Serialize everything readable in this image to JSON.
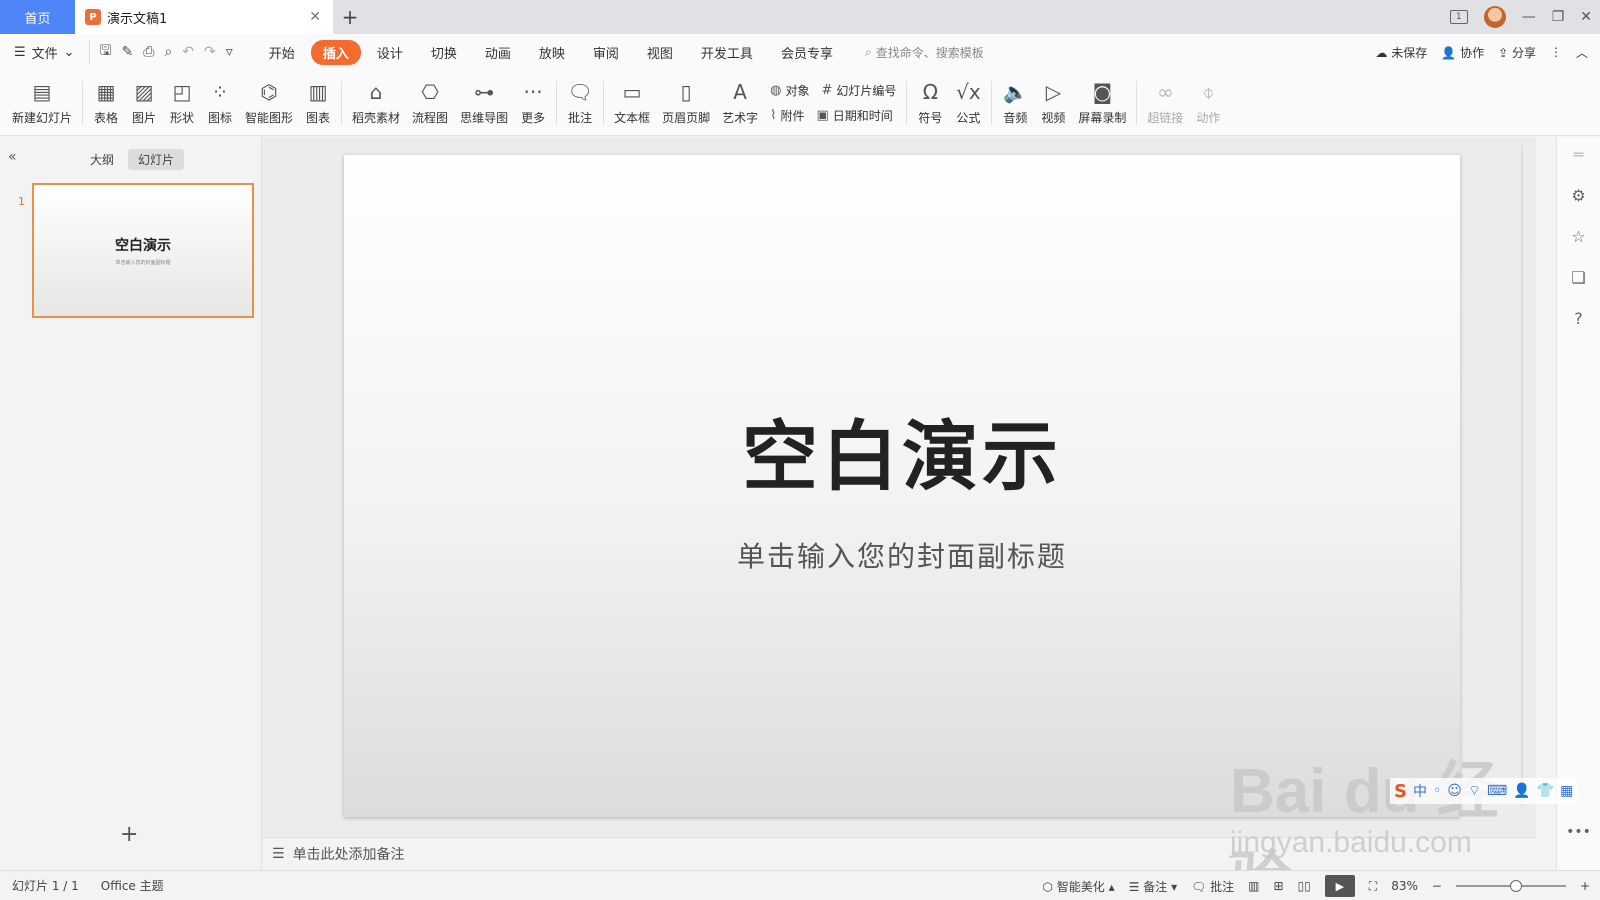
{
  "titlebar": {
    "home_tab": "首页",
    "doc_tab": "演示文稿1",
    "doc_icon": "P",
    "window_badge": "1"
  },
  "menu": {
    "file": "文件",
    "tabs": [
      "开始",
      "插入",
      "设计",
      "切换",
      "动画",
      "放映",
      "审阅",
      "视图",
      "开发工具",
      "会员专享"
    ],
    "active_tab": "插入",
    "search_placeholder": "查找命令、搜索模板",
    "unsaved": "未保存",
    "collab": "协作",
    "share": "分享"
  },
  "ribbon": {
    "new_slide": "新建幻灯片",
    "table": "表格",
    "picture": "图片",
    "shape": "形状",
    "icon": "图标",
    "smart_graphic": "智能图形",
    "chart": "图表",
    "docer_material": "稻壳素材",
    "flowchart": "流程图",
    "mindmap": "思维导图",
    "more": "更多",
    "comment": "批注",
    "textbox": "文本框",
    "header_footer": "页眉页脚",
    "wordart": "艺术字",
    "object": "对象",
    "slide_number": "幻灯片编号",
    "attachment": "附件",
    "datetime": "日期和时间",
    "symbol": "符号",
    "formula": "公式",
    "audio": "音频",
    "video": "视频",
    "screen_record": "屏幕录制",
    "hyperlink": "超链接",
    "action": "动作"
  },
  "left_panel": {
    "outline_tab": "大纲",
    "slides_tab": "幻灯片",
    "slide_number": "1",
    "thumb_title": "空白演示",
    "thumb_subtitle": "单击输入您的封面副标题"
  },
  "slide": {
    "title": "空白演示",
    "subtitle": "单击输入您的封面副标题"
  },
  "notes": {
    "placeholder": "单击此处添加备注"
  },
  "status": {
    "slide_count": "幻灯片 1 / 1",
    "theme": "Office 主题",
    "beautify": "智能美化",
    "notes": "备注",
    "comment": "批注",
    "zoom": "83%"
  },
  "watermark": {
    "brand": "Bai du 经验",
    "url": "jingyan.baidu.com"
  }
}
